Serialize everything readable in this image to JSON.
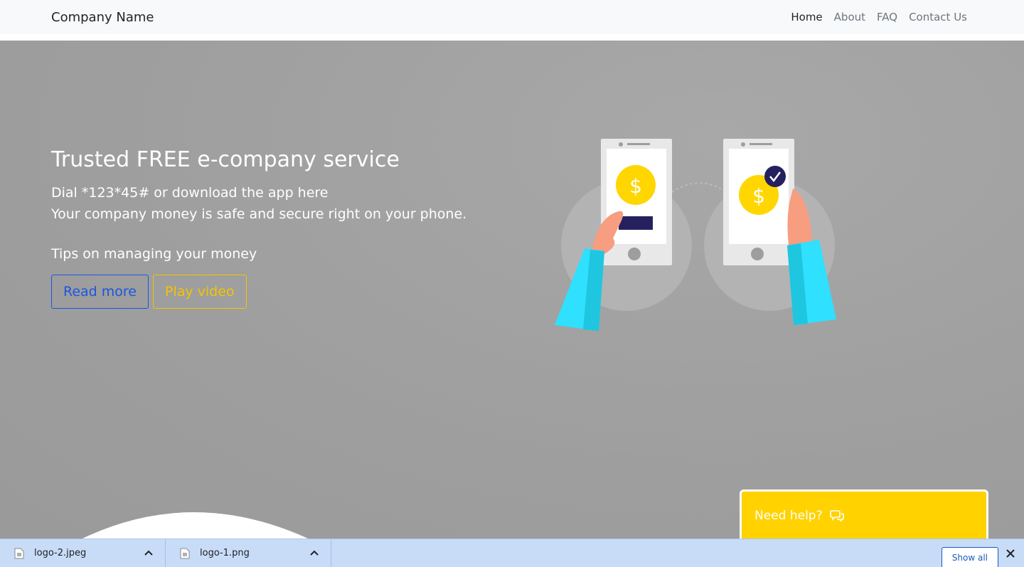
{
  "navbar": {
    "brand": "Company Name",
    "links": [
      "Home",
      "About",
      "FAQ",
      "Contact Us"
    ]
  },
  "hero": {
    "title": "Trusted FREE e-company service",
    "line1": "Dial *123*45# or download the app here",
    "line2": "Your company money is safe and secure right on your phone.",
    "tips": "Tips on managing your money",
    "read_more": "Read more",
    "play_video": "Play video",
    "illustration": {
      "icon": "phone-payment-illustration",
      "currency_symbol": "$",
      "colors": {
        "coin": "#ffd600",
        "sleeve": "#2fe0ff",
        "hand": "#f79d80",
        "check": "#25215f"
      }
    }
  },
  "help": {
    "label": "Need help?",
    "icon": "chat-icon"
  },
  "downloads": {
    "items": [
      {
        "name": "logo-2.jpeg"
      },
      {
        "name": "logo-1.png"
      }
    ],
    "show_all": "Show all"
  },
  "colors": {
    "accent_blue": "#1b55e2",
    "accent_yellow": "#f5c400",
    "help_bg": "#ffd200"
  }
}
